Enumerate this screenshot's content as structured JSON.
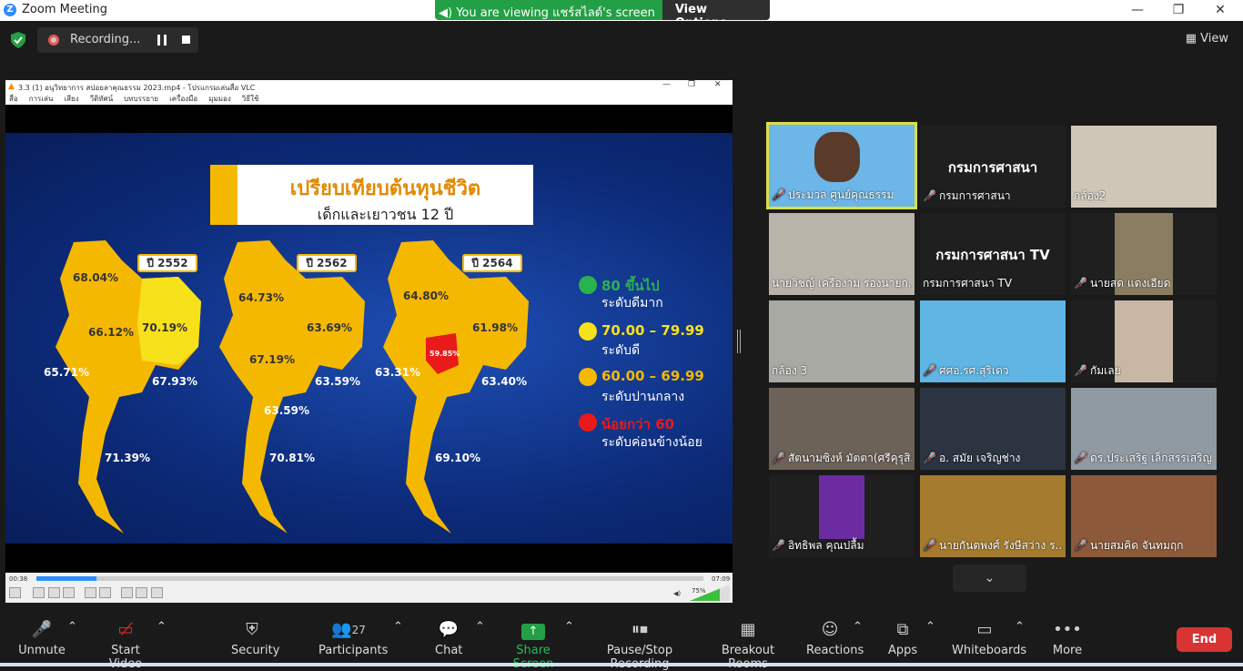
{
  "window": {
    "title": "Zoom Meeting",
    "minimize": "—",
    "restore": "❐",
    "close": "✕"
  },
  "share_banner": {
    "text": "You are viewing แชร์สไลด์'s screen",
    "options_label": "View Options"
  },
  "recording": {
    "label": "Recording..."
  },
  "view_button": {
    "label": "View"
  },
  "vlc": {
    "title": "3.3 (1) อนุวิทยาการ สปอยลาคุณธรรม 2023.mp4 - โปรแกรมเล่นสื่อ VLC",
    "menu": [
      "สื่อ",
      "การเล่น",
      "เสียง",
      "วีดิทัศน์",
      "บทบรรยาย",
      "เครื่องมือ",
      "มุมมอง",
      "วิธีใช้"
    ],
    "time_current": "00:38",
    "time_total": "07:09",
    "progress_fraction": 0.09,
    "volume": "75%"
  },
  "slide": {
    "title": "เปรียบเทียบต้นทุนชีวิต",
    "subtitle": "เด็กและเยาวชน 12 ปี",
    "maps": [
      {
        "year": "ปี 2552",
        "values": [
          "68.04%",
          "66.12%",
          "70.19%",
          "65.71%",
          "67.93%",
          "71.39%"
        ]
      },
      {
        "year": "ปี 2562",
        "values": [
          "64.73%",
          "63.69%",
          "67.19%",
          "63.59%",
          "63.59%",
          "70.81%"
        ]
      },
      {
        "year": "ปี 2564",
        "values": [
          "64.80%",
          "61.98%",
          "59.85%",
          "63.31%",
          "63.40%",
          "69.10%"
        ]
      }
    ],
    "legend": [
      {
        "range": "80 ขึ้นไป",
        "level": "ระดับดีมาก",
        "color": "#2bb24c"
      },
      {
        "range": "70.00 – 79.99",
        "level": "ระดับดี",
        "color": "#f7e11b"
      },
      {
        "range": "60.00 – 69.99",
        "level": "ระดับปานกลาง",
        "color": "#f5b800"
      },
      {
        "range": "น้อยกว่า 60",
        "level": "ระดับค่อนข้างน้อย",
        "color": "#e81a1a"
      }
    ]
  },
  "participants_gallery": [
    {
      "name": "ประมวล ศูนย์คุณธรรม",
      "muted": true,
      "active": true
    },
    {
      "name": "กรมการศาสนา",
      "muted": true,
      "big_label": "กรมการศาสนา"
    },
    {
      "name": "กล้อง2",
      "muted": false
    },
    {
      "name": "นายวิชญ์ เครืองาม รองนายก...",
      "muted": false
    },
    {
      "name": "กรมการศาสนา TV",
      "muted": false,
      "big_label": "กรมการศาสนา TV"
    },
    {
      "name": "นายสด แดงเอียด",
      "muted": true
    },
    {
      "name": "กล้อง 3",
      "muted": false
    },
    {
      "name": "ศศอ.รศ.สุริเดว",
      "muted": true
    },
    {
      "name": "กัมเลย",
      "muted": true
    },
    {
      "name": "สัตนามซิงห์ มัตตา(ศรีคุรุสิ...",
      "muted": true
    },
    {
      "name": "อ. สมัย เจริญช่าง",
      "muted": true
    },
    {
      "name": "ดร.ประเสริฐ เล็กสรรเสริญ",
      "muted": true
    },
    {
      "name": "อิทธิพล คุณปลื้ม",
      "muted": true
    },
    {
      "name": "นายกันตพงศ์ รังษีสว่าง ร...",
      "muted": true
    },
    {
      "name": "นายสมคิด จันทมฤก",
      "muted": true
    }
  ],
  "toolbar": {
    "unmute": "Unmute",
    "start_video": "Start Video",
    "security": "Security",
    "participants": "Participants",
    "participants_count": "27",
    "chat": "Chat",
    "share_screen": "Share Screen",
    "pause_stop_recording": "Pause/Stop Recording",
    "breakout_rooms": "Breakout Rooms",
    "reactions": "Reactions",
    "apps": "Apps",
    "whiteboards": "Whiteboards",
    "more": "More",
    "end": "End"
  },
  "colors": {
    "share_green": "#23a045",
    "end_red": "#d83434",
    "active_border": "#d8e04a",
    "zoom_blue": "#2d8cff"
  }
}
